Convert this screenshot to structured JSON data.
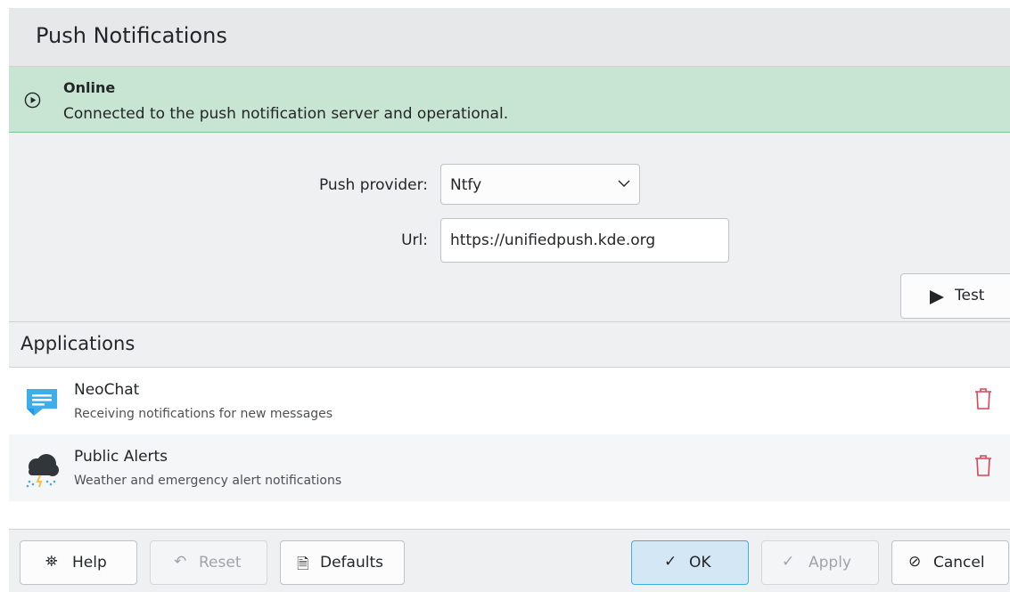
{
  "header": {
    "title": "Push Notifications"
  },
  "status": {
    "title": "Online",
    "message": "Connected to the push notification server and operational.",
    "icon": "play-circle-icon",
    "color": "#c7e5d2"
  },
  "settings": {
    "provider_label": "Push provider:",
    "provider_value": "Ntfy",
    "url_label": "Url:",
    "url_value": "https://unifiedpush.kde.org",
    "test_label": "Test"
  },
  "applications": {
    "title": "Applications",
    "items": [
      {
        "name": "NeoChat",
        "description": "Receiving notifications for new messages",
        "icon": "neochat-icon"
      },
      {
        "name": "Public Alerts",
        "description": "Weather and emergency alert notifications",
        "icon": "weather-alert-icon"
      }
    ]
  },
  "footer": {
    "help": "Help",
    "reset": "Reset",
    "defaults": "Defaults",
    "ok": "OK",
    "apply": "Apply",
    "cancel": "Cancel"
  }
}
